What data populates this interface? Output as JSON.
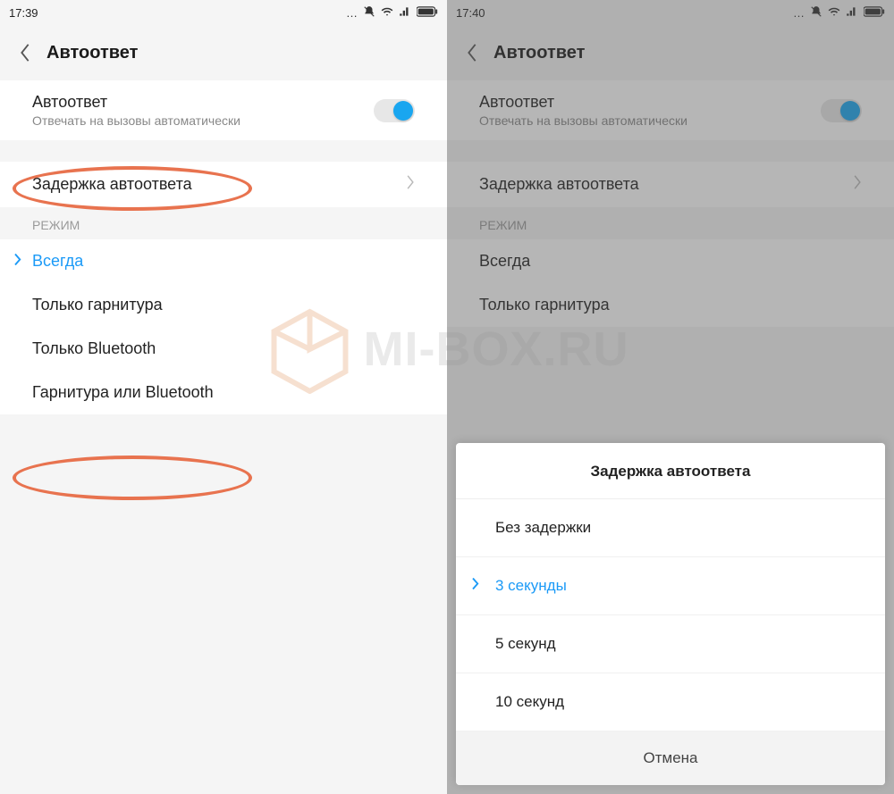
{
  "watermark": "MI-BOX.RU",
  "left": {
    "time": "17:39",
    "status_icons": [
      "mute-icon",
      "wifi-icon",
      "signal-icon",
      "battery-icon"
    ],
    "title": "Автоответ",
    "auto": {
      "label": "Автоответ",
      "sub": "Отвечать на вызовы автоматически"
    },
    "delay_row": "Задержка автоответа",
    "section": "РЕЖИМ",
    "modes": {
      "always": "Всегда",
      "headset": "Только гарнитура",
      "bluetooth": "Только Bluetooth",
      "headset_or_bt": "Гарнитура или Bluetooth"
    }
  },
  "right": {
    "time": "17:40",
    "status_icons": [
      "mute-icon",
      "wifi-icon",
      "signal-icon",
      "battery-icon"
    ],
    "title": "Автоответ",
    "auto": {
      "label": "Автоответ",
      "sub": "Отвечать на вызовы автоматически"
    },
    "delay_row": "Задержка автоответа",
    "section": "РЕЖИМ",
    "modes": {
      "always": "Всегда",
      "headset": "Только гарнитура"
    },
    "sheet": {
      "title": "Задержка автоответа",
      "options": [
        "Без задержки",
        "3 секунды",
        "5 секунд",
        "10 секунд"
      ],
      "selected_index": 1,
      "cancel": "Отмена"
    }
  }
}
